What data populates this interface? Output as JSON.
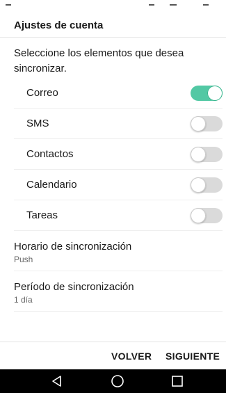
{
  "header": {
    "title": "Ajustes de cuenta"
  },
  "prompt": "Seleccione los elementos que desea sincronizar.",
  "sync_items": [
    {
      "label": "Correo",
      "enabled": true
    },
    {
      "label": "SMS",
      "enabled": false
    },
    {
      "label": "Contactos",
      "enabled": false
    },
    {
      "label": "Calendario",
      "enabled": false
    },
    {
      "label": "Tareas",
      "enabled": false
    }
  ],
  "settings": {
    "schedule": {
      "title": "Horario de sincronización",
      "value": "Push"
    },
    "period": {
      "title": "Período de sincronización",
      "value": "1 día"
    }
  },
  "footer": {
    "back_label": "VOLVER",
    "next_label": "SIGUIENTE"
  },
  "colors": {
    "accent": "#52c8a4",
    "toggle_off": "#dadada",
    "nav_bar": "#000000"
  },
  "nav_icons": [
    "back-triangle-icon",
    "home-circle-icon",
    "recents-square-icon"
  ]
}
